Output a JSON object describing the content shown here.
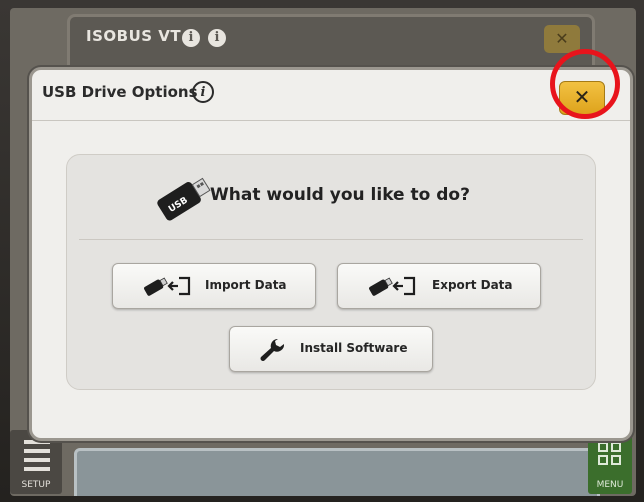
{
  "background_window": {
    "title": "ISOBUS VT",
    "close_icon": "close-icon"
  },
  "dialog": {
    "title": "USB Drive Options",
    "info_symbol": "i",
    "close_symbol": "✕",
    "prompt": "What would you like to do?",
    "buttons": {
      "import_label": "Import Data",
      "export_label": "Export Data",
      "install_label": "Install Software"
    }
  },
  "sidebar": {
    "setup_label": "SETUP",
    "menu_label": "MENU"
  },
  "colors": {
    "close_button": "#e8b12a",
    "highlight_ring": "#e8141c",
    "menu_button": "#3b6e2c"
  }
}
